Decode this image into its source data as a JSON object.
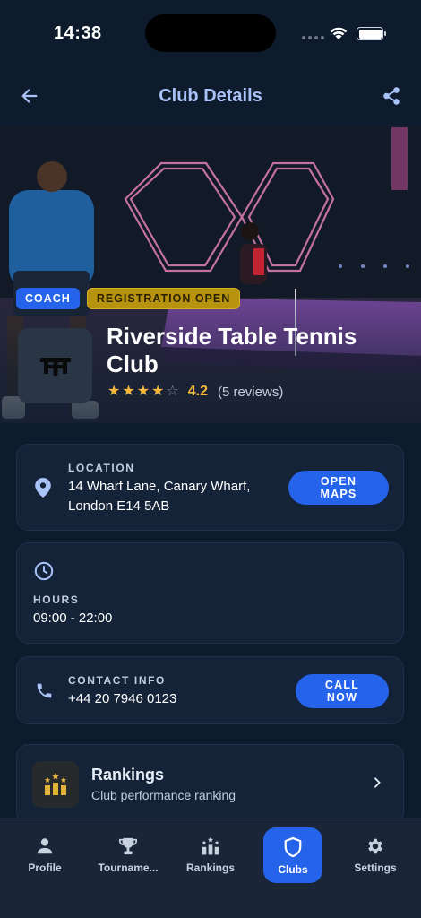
{
  "status_bar": {
    "time": "14:38"
  },
  "header": {
    "title": "Club Details"
  },
  "club": {
    "badges": {
      "coach": "COACH",
      "registration": "REGISTRATION OPEN"
    },
    "name": "Riverside Table Tennis Club",
    "rating": {
      "stars_filled": 4,
      "stars_total": 5,
      "value": "4.2",
      "reviews": "(5 reviews)"
    }
  },
  "location": {
    "label": "LOCATION",
    "address_line1": "14 Wharf Lane, Canary Wharf,",
    "address_line2": "London E14 5AB",
    "button": "OPEN MAPS"
  },
  "hours": {
    "label": "HOURS",
    "value": "09:00 - 22:00"
  },
  "contact": {
    "label": "CONTACT INFO",
    "phone": "+44 20 7946 0123",
    "button": "CALL NOW"
  },
  "rankings_card": {
    "title": "Rankings",
    "subtitle": "Club performance ranking"
  },
  "nav": {
    "profile": "Profile",
    "tournaments": "Tourname...",
    "rankings": "Rankings",
    "clubs": "Clubs",
    "settings": "Settings",
    "active": "clubs"
  },
  "colors": {
    "accent": "#2563eb",
    "background": "#0d1b2d",
    "star": "#f4b73a",
    "registration_badge": "#b8930f",
    "title": "#a9c2f7"
  },
  "icons": {
    "back": "arrow-left-icon",
    "share": "share-icon",
    "location": "map-pin-icon",
    "clock": "clock-icon",
    "phone": "phone-icon",
    "rankings": "podium-stars-icon",
    "chevron": "chevron-right-icon",
    "profile": "person-icon",
    "tournaments": "trophy-icon",
    "clubs": "shield-icon",
    "settings": "gear-icon"
  }
}
